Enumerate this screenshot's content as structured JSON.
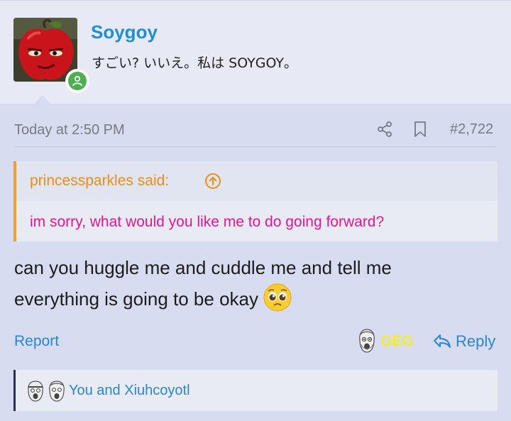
{
  "post": {
    "author": {
      "username": "Soygoy",
      "user_title": "すごい? いいえ。私は SOYGOY。",
      "avatar_icon": "apple-face-avatar",
      "online": true
    },
    "date": "Today at 2:50 PM",
    "number": "#2,722",
    "quote": {
      "author_label": "princessparkles said:",
      "text": "im sorry, what would you like me to do going forward?"
    },
    "message": {
      "line1": "can you huggle me and cuddle me and tell me",
      "line2": "everything is going to be okay",
      "emoji": "pleading-face-emoji"
    },
    "actions": {
      "report_label": "Report",
      "reaction_label": "GEG",
      "reply_label": "Reply"
    },
    "reactions_summary": "You and Xiuhcoyotl"
  },
  "colors": {
    "accent_blue": "#1e8fd6",
    "link_blue": "#2a86d4",
    "quote_author": "#e98f1a",
    "quote_text": "#e6188f",
    "geg_yellow": "#f2ee2a",
    "online_green": "#4caf50"
  }
}
